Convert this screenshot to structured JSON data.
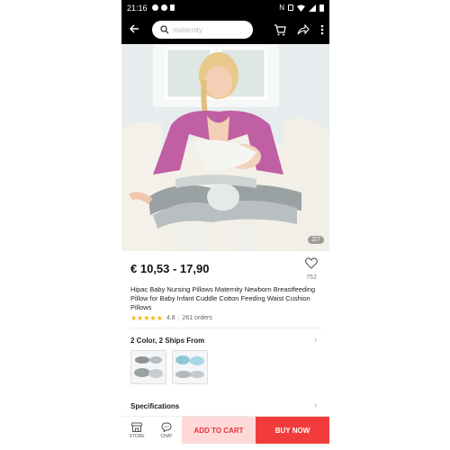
{
  "status": {
    "time": "21:16"
  },
  "search": {
    "placeholder": "maternity"
  },
  "gallery": {
    "pager": "2/7"
  },
  "product": {
    "price": "€ 10,53 - 17,90",
    "wishlist_count": "752",
    "title": "Hipac Baby Nursing Pillows Maternity Newborn Breastfeeding Pillow for Baby Infant Cuddle Cotton Feeding Waist Cushion Pillows",
    "rating": "4.8",
    "orders": "261 orders"
  },
  "variants": {
    "heading": "2 Color, 2 Ships From"
  },
  "specifications": {
    "heading": "Specifications"
  },
  "bottom": {
    "store_label": "STORE",
    "chat_label": "CHAT",
    "add_to_cart": "ADD TO CART",
    "buy_now": "BUY NOW"
  },
  "colors": {
    "accent": "#f23c3c",
    "accent_light": "#ffd8d8",
    "star": "#f5b400"
  }
}
